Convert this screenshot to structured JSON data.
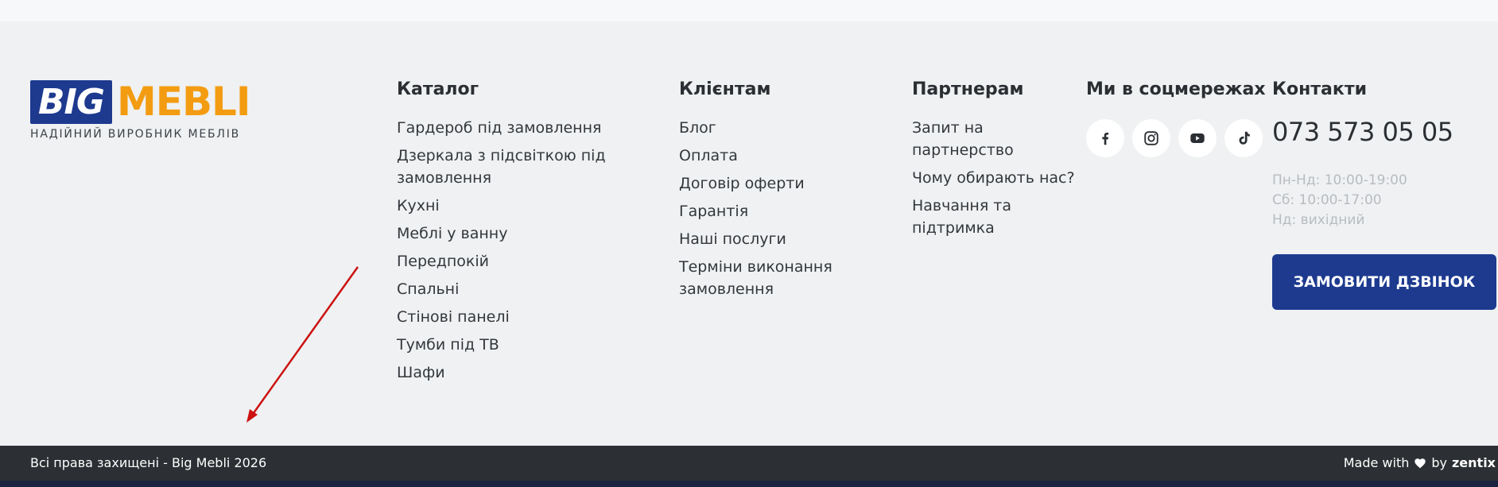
{
  "logo": {
    "big": "BIG",
    "mebli": "MEBLI",
    "tagline": "НАДІЙНИЙ ВИРОБНИК МЕБЛІВ"
  },
  "catalog": {
    "title": "Каталог",
    "items": [
      "Гардероб під замовлення",
      "Дзеркала з підсвіткою під замовлення",
      "Кухні",
      "Меблі у ванну",
      "Передпокій",
      "Спальні",
      "Стінові панелі",
      "Тумби під ТВ",
      "Шафи"
    ]
  },
  "clients": {
    "title": "Клієнтам",
    "items": [
      "Блог",
      "Оплата",
      "Договір оферти",
      "Гарантія",
      "Наші послуги",
      "Терміни виконання замовлення"
    ]
  },
  "partners": {
    "title": "Партнерам",
    "items": [
      "Запит на партнерство",
      "Чому обирають нас?",
      "Навчання та підтримка"
    ]
  },
  "social": {
    "title": "Ми в соцмережах",
    "icons": [
      "facebook-icon",
      "instagram-icon",
      "youtube-icon",
      "tiktok-icon"
    ]
  },
  "contacts": {
    "title": "Контакти",
    "phone": "073 573 05 05",
    "hours": [
      "Пн-Нд: 10:00-19:00",
      "Сб: 10:00-17:00",
      "Нд: вихідний"
    ],
    "call_button": "ЗАМОВИТИ ДЗВІНОК"
  },
  "footer": {
    "copyright": "Всі права захищені - Big Mebli 2026",
    "made_with": "Made with",
    "by": "by",
    "brand": "zentix"
  },
  "colors": {
    "brand_blue": "#1d3a8f",
    "brand_orange": "#f39c12",
    "annotation_red": "#cc1111"
  }
}
